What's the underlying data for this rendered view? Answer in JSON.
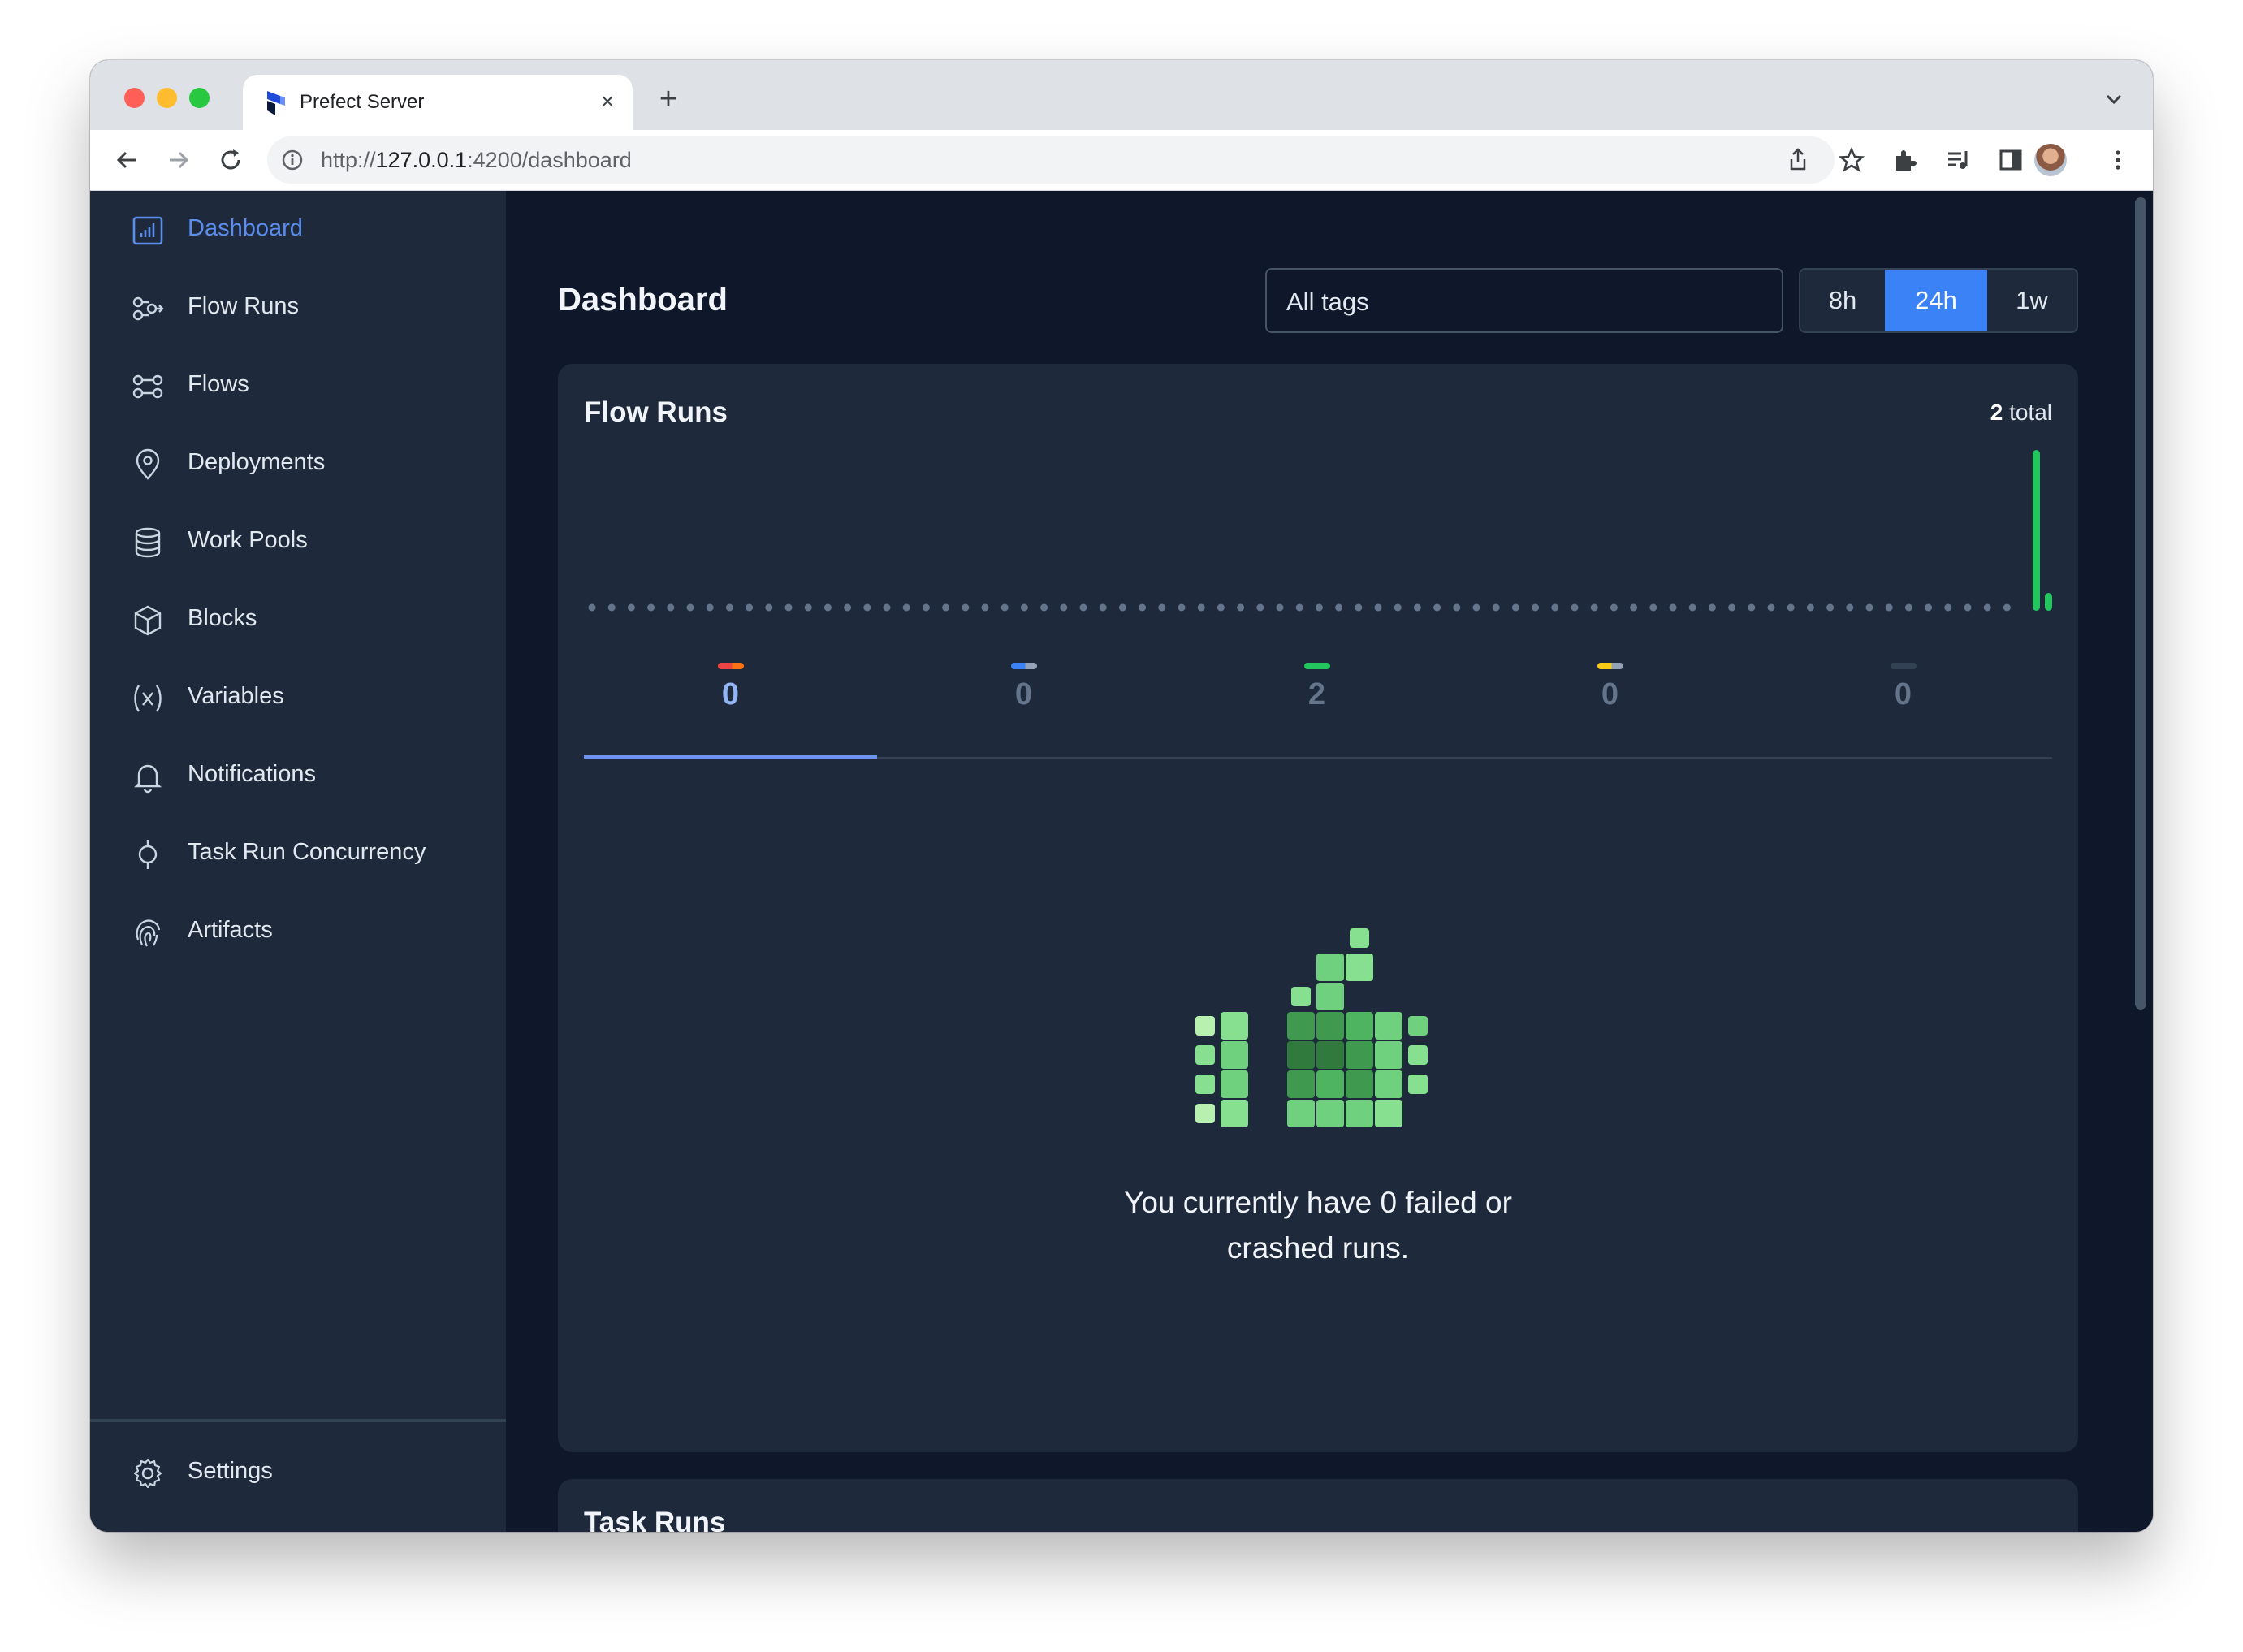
{
  "browser": {
    "tab_title": "Prefect Server",
    "tab_close_glyph": "×",
    "new_tab_glyph": "+",
    "url_prefix": "http://",
    "url_host": "127.0.0.1",
    "url_path": ":4200/dashboard"
  },
  "sidebar": {
    "items": [
      {
        "label": "Dashboard",
        "icon": "dashboard-icon",
        "active": true
      },
      {
        "label": "Flow Runs",
        "icon": "flow-runs-icon"
      },
      {
        "label": "Flows",
        "icon": "flows-icon"
      },
      {
        "label": "Deployments",
        "icon": "map-pin-icon"
      },
      {
        "label": "Work Pools",
        "icon": "database-icon"
      },
      {
        "label": "Blocks",
        "icon": "cube-icon"
      },
      {
        "label": "Variables",
        "icon": "variable-icon"
      },
      {
        "label": "Notifications",
        "icon": "bell-icon"
      },
      {
        "label": "Task Run Concurrency",
        "icon": "concurrency-icon"
      },
      {
        "label": "Artifacts",
        "icon": "fingerprint-icon"
      }
    ],
    "settings": {
      "label": "Settings",
      "icon": "gear-icon"
    }
  },
  "dashboard": {
    "title": "Dashboard",
    "tags_filter": "All tags",
    "ranges": [
      {
        "label": "8h"
      },
      {
        "label": "24h",
        "active": true
      },
      {
        "label": "1w"
      }
    ],
    "flow_runs_card": {
      "title": "Flow Runs",
      "total_count": "2",
      "total_suffix": " total",
      "states": [
        {
          "count": "0",
          "colors": [
            "#ef4444",
            "#f97316"
          ]
        },
        {
          "count": "0",
          "colors": [
            "#3b82f6",
            "#94a3b8"
          ]
        },
        {
          "count": "2",
          "colors": [
            "#22c55e",
            "#22c55e"
          ]
        },
        {
          "count": "0",
          "colors": [
            "#facc15",
            "#94a3b8"
          ]
        },
        {
          "count": "0",
          "colors": [
            "#334155",
            "#334155"
          ]
        }
      ],
      "empty_message_line1": "You currently have 0 failed or",
      "empty_message_line2": "crashed runs."
    },
    "task_runs_card": {
      "title": "Task Runs"
    }
  },
  "colors": {
    "accent": "#3b82f6",
    "success": "#22c55e",
    "sidebar_bg": "#1e293b",
    "main_bg": "#0f172a"
  }
}
